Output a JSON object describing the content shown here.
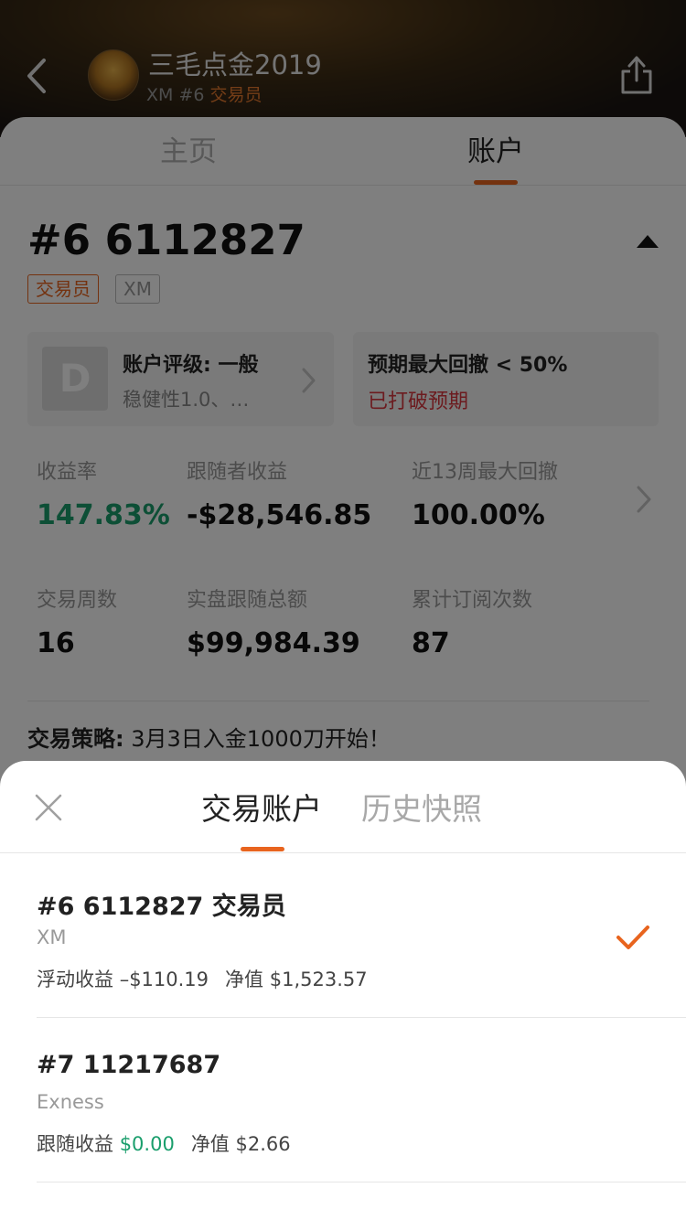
{
  "header": {
    "title": "三毛点金2019",
    "subtitle_prefix": "XM #6 ",
    "subtitle_role": "交易员",
    "icons": {
      "back": "chevron-left-icon",
      "share": "share-icon",
      "avatar": "avatar-image"
    }
  },
  "tabs": [
    {
      "label": "主页",
      "active": false
    },
    {
      "label": "账户",
      "active": true
    }
  ],
  "account": {
    "number": "#6 6112827",
    "tags": [
      "交易员",
      "XM"
    ],
    "rating": {
      "grade": "D",
      "title": "账户评级: 一般",
      "subtitle": "稳健性1.0、…"
    },
    "drawdown": {
      "title": "预期最大回撤 < 50%",
      "status": "已打破预期"
    },
    "stats": [
      {
        "label": "收益率",
        "value": "147.83%",
        "color": "#1a9e6c"
      },
      {
        "label": "跟随者收益",
        "value": "-$28,546.85",
        "color": "#111111"
      },
      {
        "label": "近13周最大回撤",
        "value": "100.00%",
        "color": "#111111"
      },
      {
        "label": "交易周数",
        "value": "16",
        "color": "#111111"
      },
      {
        "label": "实盘跟随总额",
        "value": "$99,984.39",
        "color": "#111111"
      },
      {
        "label": "累计订阅次数",
        "value": "87",
        "color": "#111111"
      }
    ],
    "strategy_label": "交易策略:",
    "strategy_text": " 3月3日入金1000刀开始！"
  },
  "sheet": {
    "tabs": [
      {
        "label": "交易账户",
        "active": true
      },
      {
        "label": "历史快照",
        "active": false
      }
    ],
    "accounts": [
      {
        "title": "#6 6112827 交易员",
        "broker": "XM",
        "metric1_label": "浮动收益",
        "metric1_value": "–$110.19",
        "metric2_label": "净值",
        "metric2_value": "$1,523.57",
        "selected": true
      },
      {
        "title": "#7 11217687",
        "broker": "Exness",
        "metric1_label": "跟随收益",
        "metric1_value": "$0.00",
        "metric2_label": "净值",
        "metric2_value": "$2.66",
        "selected": false
      }
    ]
  },
  "colors": {
    "accent": "#e8641e",
    "positive": "#1a9e6c",
    "negative": "#d9363e"
  }
}
